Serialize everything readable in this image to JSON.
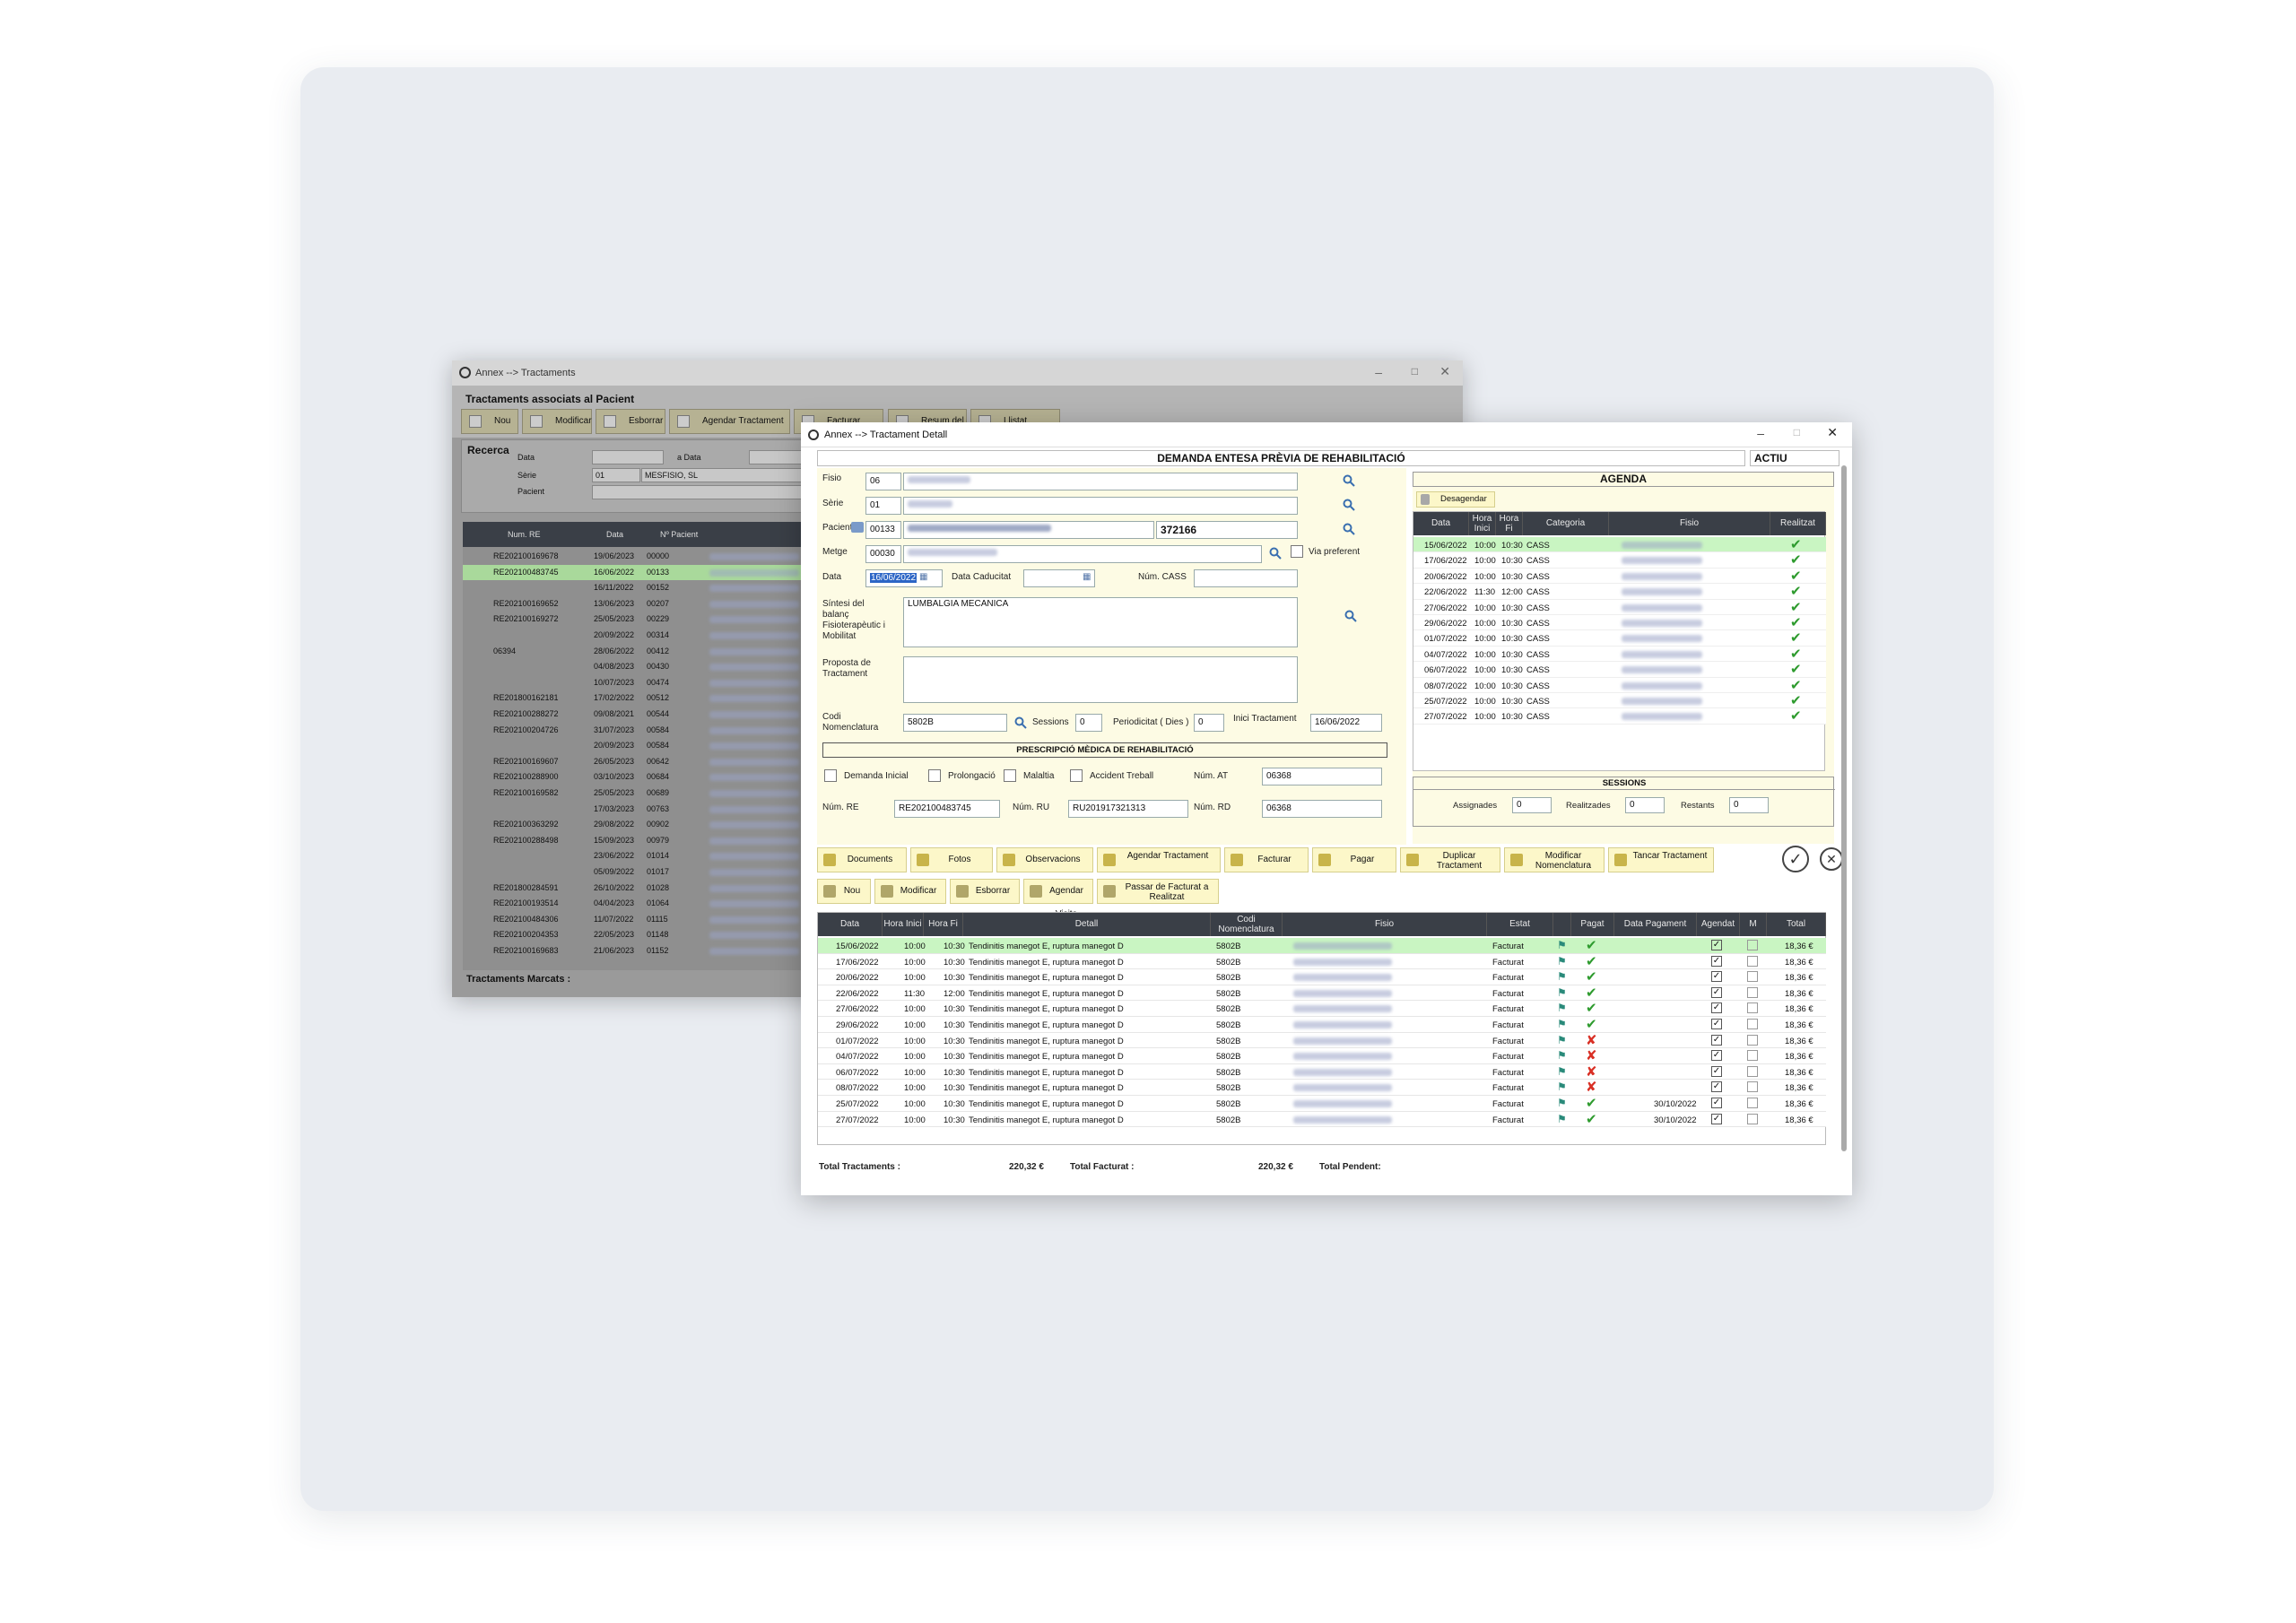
{
  "back_window": {
    "title": "Annex --> Tractaments",
    "heading": "Tractaments associats al Pacient",
    "toolbar": [
      "Nou",
      "Modificar",
      "Esborrar",
      "Agendar Tractament",
      "Facturar",
      "Resum del Dia",
      "Llistat Factura"
    ],
    "search": {
      "title": "Recerca",
      "data_label": "Data",
      "a_data_label": "a Data",
      "serie_label": "Sèrie",
      "serie_code": "01",
      "serie_name": "MESFISIO, SL",
      "pacient_label": "Pacient"
    },
    "columns": [
      "Num. RE",
      "Data",
      "Nº Pacient"
    ],
    "rows": [
      [
        "RE202100169678",
        "19/06/2023",
        "00000"
      ],
      [
        "RE202100483745",
        "16/06/2022",
        "00133"
      ],
      [
        "",
        "16/11/2022",
        "00152"
      ],
      [
        "RE202100169652",
        "13/06/2023",
        "00207"
      ],
      [
        "RE202100169272",
        "25/05/2023",
        "00229"
      ],
      [
        "",
        "20/09/2022",
        "00314"
      ],
      [
        "06394",
        "28/06/2022",
        "00412"
      ],
      [
        "",
        "04/08/2023",
        "00430"
      ],
      [
        "",
        "10/07/2023",
        "00474"
      ],
      [
        "RE201800162181",
        "17/02/2022",
        "00512"
      ],
      [
        "RE202100288272",
        "09/08/2021",
        "00544"
      ],
      [
        "RE202100204726",
        "31/07/2023",
        "00584"
      ],
      [
        "",
        "20/09/2023",
        "00584"
      ],
      [
        "RE202100169607",
        "26/05/2023",
        "00642"
      ],
      [
        "RE202100288900",
        "03/10/2023",
        "00684"
      ],
      [
        "RE202100169582",
        "25/05/2023",
        "00689"
      ],
      [
        "",
        "17/03/2023",
        "00763"
      ],
      [
        "RE202100363292",
        "29/08/2022",
        "00902"
      ],
      [
        "RE202100288498",
        "15/09/2023",
        "00979"
      ],
      [
        "",
        "23/06/2022",
        "01014"
      ],
      [
        "",
        "05/09/2022",
        "01017"
      ],
      [
        "RE201800284591",
        "26/10/2022",
        "01028"
      ],
      [
        "RE202100193514",
        "04/04/2023",
        "01064"
      ],
      [
        "RE202100484306",
        "11/07/2022",
        "01115"
      ],
      [
        "RE202100204353",
        "22/05/2023",
        "01148"
      ],
      [
        "RE202100169683",
        "21/06/2023",
        "01152"
      ]
    ],
    "footer": "Tractaments Marcats :"
  },
  "front_window": {
    "title": "Annex --> Tractament Detall",
    "banner": "DEMANDA ENTESA PRÈVIA DE REHABILITACIÓ",
    "status": "ACTIU",
    "form": {
      "fisio_label": "Fisio",
      "fisio_code": "06",
      "serie_label": "Sèrie",
      "serie_code": "01",
      "pacient_label": "Pacient",
      "pacient_code": "00133",
      "pacient_num": "372166",
      "metge_label": "Metge",
      "metge_code": "00030",
      "via_preferent": "Via preferent",
      "data_label": "Data",
      "data_value": "16/06/2022",
      "data_caducitat_label": "Data Caducitat",
      "num_cass_label": "Núm. CASS",
      "sintesi_label": "Síntesi del balanç Fisioterapèutic i Mobilitat",
      "sintesi_value": "LUMBALGIA MECANICA",
      "proposta_label": "Proposta de Tractament",
      "codi_nom_label": "Codi Nomenclatura",
      "codi_nom_value": "5802B",
      "sessions_label": "Sessions",
      "sessions_value": "0",
      "periodicitat_label": "Periodicitat ( Dies )",
      "periodicitat_value": "0",
      "inici_label": "Inici Tractament",
      "inici_value": "16/06/2022",
      "prescripcio": "PRESCRIPCIÓ MÈDICA DE REHABILITACIÓ",
      "chk_demanda": "Demanda Inicial",
      "chk_prolongacio": "Prolongació",
      "chk_malaltia": "Malaltia",
      "chk_accident": "Accident Treball",
      "num_at_label": "Núm. AT",
      "num_at_value": "06368",
      "num_re_label": "Núm. RE",
      "num_re_value": "RE202100483745",
      "num_ru_label": "Núm. RU",
      "num_ru_value": "RU201917321313",
      "num_rd_label": "Núm. RD",
      "num_rd_value": "06368"
    },
    "agenda": {
      "title": "AGENDA",
      "desagendar": "Desagendar",
      "columns": [
        "Data",
        "Hora Inici",
        "Hora Fi",
        "Categoria",
        "Fisio",
        "Realitzat"
      ],
      "rows": [
        [
          "15/06/2022",
          "10:00",
          "10:30",
          "CASS"
        ],
        [
          "17/06/2022",
          "10:00",
          "10:30",
          "CASS"
        ],
        [
          "20/06/2022",
          "10:00",
          "10:30",
          "CASS"
        ],
        [
          "22/06/2022",
          "11:30",
          "12:00",
          "CASS"
        ],
        [
          "27/06/2022",
          "10:00",
          "10:30",
          "CASS"
        ],
        [
          "29/06/2022",
          "10:00",
          "10:30",
          "CASS"
        ],
        [
          "01/07/2022",
          "10:00",
          "10:30",
          "CASS"
        ],
        [
          "04/07/2022",
          "10:00",
          "10:30",
          "CASS"
        ],
        [
          "06/07/2022",
          "10:00",
          "10:30",
          "CASS"
        ],
        [
          "08/07/2022",
          "10:00",
          "10:30",
          "CASS"
        ],
        [
          "25/07/2022",
          "10:00",
          "10:30",
          "CASS"
        ],
        [
          "27/07/2022",
          "10:00",
          "10:30",
          "CASS"
        ]
      ],
      "sessions_title": "SESSIONS",
      "assignades_label": "Assignades",
      "assignades": "0",
      "realitzades_label": "Realitzades",
      "realitzades": "0",
      "restants_label": "Restants",
      "restants": "0"
    },
    "toolbar1": [
      "Documents",
      "Fotos",
      "Observacions",
      "Agendar Tractament",
      "Facturar",
      "Pagar",
      "Duplicar Tractament",
      "Modificar Nomenclatura",
      "Tancar Tractament"
    ],
    "toolbar2": [
      "Nou",
      "Modificar",
      "Esborrar",
      "Agendar Visita",
      "Passar de Facturat a Realitzat"
    ],
    "grid": {
      "columns": [
        "Data",
        "Hora Inici",
        "Hora Fi",
        "Detall",
        "Codi Nomenclatura",
        "Fisio",
        "Estat",
        "",
        "Pagat",
        "Data Pagament",
        "Agendat",
        "M",
        "Total"
      ],
      "rows": [
        {
          "data": "15/06/2022",
          "hi": "10:00",
          "hf": "10:30",
          "detall": "Tendinitis manegot E, ruptura manegot D",
          "codi": "5802B",
          "estat": "Facturat",
          "pagat": true,
          "data_pag": "",
          "total": "18,36 €"
        },
        {
          "data": "17/06/2022",
          "hi": "10:00",
          "hf": "10:30",
          "detall": "Tendinitis manegot E, ruptura manegot D",
          "codi": "5802B",
          "estat": "Facturat",
          "pagat": true,
          "data_pag": "",
          "total": "18,36 €"
        },
        {
          "data": "20/06/2022",
          "hi": "10:00",
          "hf": "10:30",
          "detall": "Tendinitis manegot E, ruptura manegot D",
          "codi": "5802B",
          "estat": "Facturat",
          "pagat": true,
          "data_pag": "",
          "total": "18,36 €"
        },
        {
          "data": "22/06/2022",
          "hi": "11:30",
          "hf": "12:00",
          "detall": "Tendinitis manegot E, ruptura manegot D",
          "codi": "5802B",
          "estat": "Facturat",
          "pagat": true,
          "data_pag": "",
          "total": "18,36 €"
        },
        {
          "data": "27/06/2022",
          "hi": "10:00",
          "hf": "10:30",
          "detall": "Tendinitis manegot E, ruptura manegot D",
          "codi": "5802B",
          "estat": "Facturat",
          "pagat": true,
          "data_pag": "",
          "total": "18,36 €"
        },
        {
          "data": "29/06/2022",
          "hi": "10:00",
          "hf": "10:30",
          "detall": "Tendinitis manegot E, ruptura manegot D",
          "codi": "5802B",
          "estat": "Facturat",
          "pagat": true,
          "data_pag": "",
          "total": "18,36 €"
        },
        {
          "data": "01/07/2022",
          "hi": "10:00",
          "hf": "10:30",
          "detall": "Tendinitis manegot E, ruptura manegot D",
          "codi": "5802B",
          "estat": "Facturat",
          "pagat": false,
          "data_pag": "",
          "total": "18,36 €"
        },
        {
          "data": "04/07/2022",
          "hi": "10:00",
          "hf": "10:30",
          "detall": "Tendinitis manegot E, ruptura manegot D",
          "codi": "5802B",
          "estat": "Facturat",
          "pagat": false,
          "data_pag": "",
          "total": "18,36 €"
        },
        {
          "data": "06/07/2022",
          "hi": "10:00",
          "hf": "10:30",
          "detall": "Tendinitis manegot E, ruptura manegot D",
          "codi": "5802B",
          "estat": "Facturat",
          "pagat": false,
          "data_pag": "",
          "total": "18,36 €"
        },
        {
          "data": "08/07/2022",
          "hi": "10:00",
          "hf": "10:30",
          "detall": "Tendinitis manegot E, ruptura manegot D",
          "codi": "5802B",
          "estat": "Facturat",
          "pagat": false,
          "data_pag": "",
          "total": "18,36 €"
        },
        {
          "data": "25/07/2022",
          "hi": "10:00",
          "hf": "10:30",
          "detall": "Tendinitis manegot E, ruptura manegot D",
          "codi": "5802B",
          "estat": "Facturat",
          "pagat": true,
          "data_pag": "30/10/2022",
          "total": "18,36 €"
        },
        {
          "data": "27/07/2022",
          "hi": "10:00",
          "hf": "10:30",
          "detall": "Tendinitis manegot E, ruptura manegot D",
          "codi": "5802B",
          "estat": "Facturat",
          "pagat": true,
          "data_pag": "30/10/2022",
          "total": "18,36 €"
        }
      ]
    },
    "totals": {
      "tractaments_label": "Total Tractaments :",
      "tractaments": "220,32 €",
      "facturat_label": "Total Facturat :",
      "facturat": "220,32 €",
      "pendent_label": "Total Pendent:"
    }
  },
  "colors": {
    "selected_row": "#c9f5c2",
    "header_dark": "#3a3f47",
    "panel_yellow": "#fdfbe4",
    "button_yellow": "#fcf7c9",
    "check_green": "#2e9b2e",
    "cross_red": "#d93025"
  }
}
